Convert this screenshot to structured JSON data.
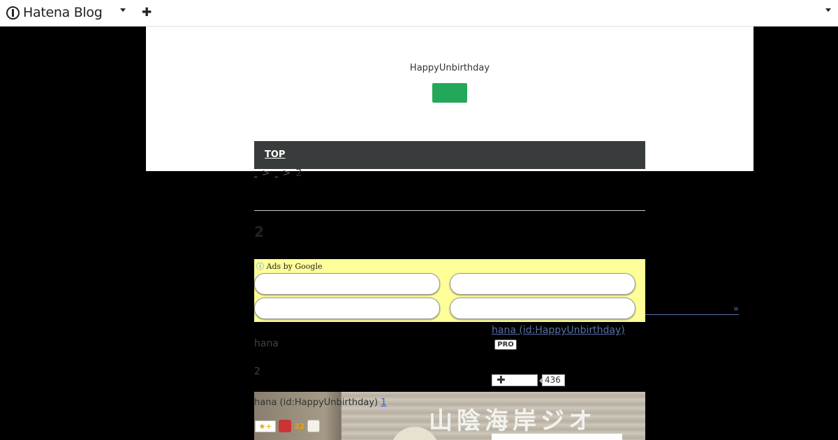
{
  "header": {
    "logo_text": "Hatena Blog",
    "icons": [
      "hatena-logo-icon",
      "caret-down-icon",
      "plus-icon",
      "caret-down-icon"
    ]
  },
  "blog": {
    "title": "HappyUnbirthday"
  },
  "nav": {
    "top_label": "TOP"
  },
  "breadcrumb": {
    "sep1": ">",
    "sep2": ">",
    "current": "2"
  },
  "entry": {
    "title": "2",
    "author_line": "hana",
    "number_line": "2",
    "photo_caption": "hana (id:HappyUnbirthday)",
    "photo_caption_link": "1",
    "photo_sign_text": "山陰海岸ジオ",
    "star_count": "32"
  },
  "ad": {
    "label": "Ads by Google",
    "info_glyph": "ⓘ"
  },
  "sidebar": {
    "more_link": "»",
    "author_name": "hana (id:HappyUnbirthday)",
    "pro_badge": "PRO",
    "follow_plus": "+",
    "follower_count": "436"
  },
  "colors": {
    "accent_green": "#23a85a",
    "nav_bg": "#383c3c",
    "link": "#5970a7",
    "ad_bg": "#ffff99"
  }
}
